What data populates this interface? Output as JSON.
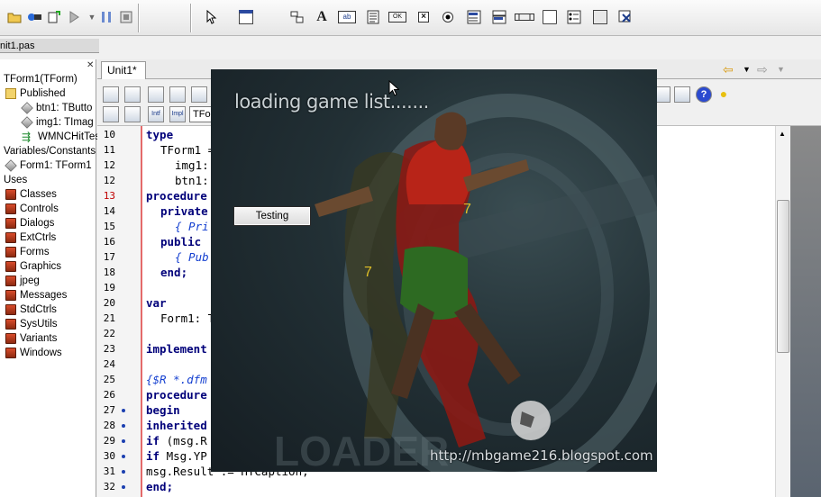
{
  "colors": {
    "accent_keyword": "#00007a",
    "comment": "#1540d0",
    "breakpoint_line": "#c00000",
    "splash_bg": "#223035",
    "splash_text": "#c9d1d4"
  },
  "toolbar": {
    "icons": [
      "open-icon",
      "save-icon",
      "undo-icon",
      "run-icon",
      "pause-icon",
      "arrow-pointer-icon",
      "frame-icon",
      "label-icon",
      "edit-icon",
      "memo-icon",
      "button-icon",
      "checkbox-icon",
      "radio-icon",
      "listbox-icon",
      "combobox-icon",
      "scrollbar-icon",
      "groupbox-icon",
      "radiogroup-icon",
      "panel-icon",
      "actionlist-icon"
    ],
    "label_glyph": "A",
    "edit_glyph": "ab",
    "button_glyph": "OK"
  },
  "file_tab": {
    "label": "nit1.pas"
  },
  "structure": {
    "items": [
      {
        "label": "TForm1(TForm)",
        "indent": 0,
        "icon": "none"
      },
      {
        "label": "Published",
        "indent": 1,
        "icon": "folder"
      },
      {
        "label": "btn1: TButto",
        "indent": 2,
        "icon": "cube"
      },
      {
        "label": "img1: TImag",
        "indent": 2,
        "icon": "cube"
      },
      {
        "label": "WMNCHitTes",
        "indent": 2,
        "icon": "green"
      },
      {
        "label": "Variables/Constants",
        "indent": 0,
        "icon": "none"
      },
      {
        "label": "Form1: TForm1",
        "indent": 1,
        "icon": "cube"
      },
      {
        "label": "Uses",
        "indent": 0,
        "icon": "none"
      },
      {
        "label": "Classes",
        "indent": 1,
        "icon": "unit"
      },
      {
        "label": "Controls",
        "indent": 1,
        "icon": "unit"
      },
      {
        "label": "Dialogs",
        "indent": 1,
        "icon": "unit"
      },
      {
        "label": "ExtCtrls",
        "indent": 1,
        "icon": "unit"
      },
      {
        "label": "Forms",
        "indent": 1,
        "icon": "unit"
      },
      {
        "label": "Graphics",
        "indent": 1,
        "icon": "unit"
      },
      {
        "label": "jpeg",
        "indent": 1,
        "icon": "unit"
      },
      {
        "label": "Messages",
        "indent": 1,
        "icon": "unit"
      },
      {
        "label": "StdCtrls",
        "indent": 1,
        "icon": "unit"
      },
      {
        "label": "SysUtils",
        "indent": 1,
        "icon": "unit"
      },
      {
        "label": "Variants",
        "indent": 1,
        "icon": "unit"
      },
      {
        "label": "Windows",
        "indent": 1,
        "icon": "unit"
      }
    ]
  },
  "editor": {
    "tab_label": "Unit1*",
    "class_combo": "TForm",
    "toolbar_labels": [
      "Intf",
      "Impl"
    ],
    "lines": [
      {
        "n": "10",
        "text": "type",
        "bp": false,
        "dot": false,
        "kind": "kw",
        "indent": 0
      },
      {
        "n": "11",
        "text": "TForm1 = ",
        "bp": false,
        "dot": false,
        "kind": "plain",
        "indent": 2
      },
      {
        "n": "12",
        "text": "img1: ",
        "bp": false,
        "dot": false,
        "kind": "plain",
        "indent": 4
      },
      {
        "n": "12",
        "text": "btn1: ",
        "bp": false,
        "dot": false,
        "kind": "plain",
        "indent": 4
      },
      {
        "n": "13",
        "text": "procedure",
        "bp": true,
        "dot": false,
        "kind": "kw",
        "indent": 0
      },
      {
        "n": "14",
        "text": "private",
        "bp": false,
        "dot": false,
        "kind": "kw",
        "indent": 2
      },
      {
        "n": "15",
        "text": "{ Pri",
        "bp": false,
        "dot": false,
        "kind": "cm",
        "indent": 4
      },
      {
        "n": "16",
        "text": "public",
        "bp": false,
        "dot": false,
        "kind": "kw",
        "indent": 2
      },
      {
        "n": "17",
        "text": "{ Pub",
        "bp": false,
        "dot": false,
        "kind": "cm",
        "indent": 4
      },
      {
        "n": "18",
        "text": "end;",
        "bp": false,
        "dot": false,
        "kind": "kw",
        "indent": 2
      },
      {
        "n": "19",
        "text": "",
        "bp": false,
        "dot": false,
        "kind": "plain",
        "indent": 0
      },
      {
        "n": "20",
        "text": "var",
        "bp": false,
        "dot": false,
        "kind": "kw",
        "indent": 0
      },
      {
        "n": "21",
        "text": "Form1: T",
        "bp": false,
        "dot": false,
        "kind": "plain",
        "indent": 2
      },
      {
        "n": "22",
        "text": "",
        "bp": false,
        "dot": false,
        "kind": "plain",
        "indent": 0
      },
      {
        "n": "23",
        "text": "implement",
        "bp": false,
        "dot": false,
        "kind": "kw",
        "indent": 0
      },
      {
        "n": "24",
        "text": "",
        "bp": false,
        "dot": false,
        "kind": "plain",
        "indent": 0
      },
      {
        "n": "25",
        "text": "{$R *.dfm",
        "bp": false,
        "dot": false,
        "kind": "cm",
        "indent": 0
      },
      {
        "n": "26",
        "text": "procedure",
        "bp": false,
        "dot": false,
        "kind": "kw",
        "indent": 0
      },
      {
        "n": "27",
        "text": "begin",
        "bp": false,
        "dot": true,
        "kind": "kw",
        "indent": 0
      },
      {
        "n": "28",
        "text": "inherited",
        "bp": false,
        "dot": true,
        "kind": "kw",
        "indent": 0
      },
      {
        "n": "29",
        "text": "if (msg.R",
        "bp": false,
        "dot": true,
        "kind": "mixed",
        "indent": 0
      },
      {
        "n": "30",
        "text": "if Msg.YP",
        "bp": false,
        "dot": true,
        "kind": "mixed",
        "indent": 0
      },
      {
        "n": "31",
        "text": "msg.Result := HTCaption;",
        "bp": false,
        "dot": true,
        "kind": "plain",
        "indent": 0
      },
      {
        "n": "32",
        "text": "end;",
        "bp": false,
        "dot": true,
        "kind": "kw",
        "indent": 0
      }
    ]
  },
  "splash": {
    "loading_text": "loading game list.......",
    "button_label": "Testing",
    "url": "http://mbgame216.blogspot.com"
  }
}
